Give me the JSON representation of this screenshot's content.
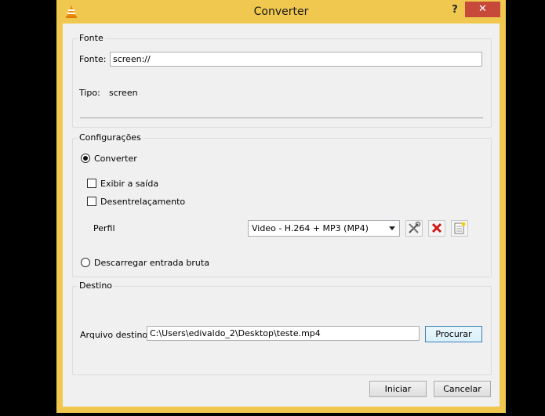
{
  "window": {
    "title": "Converter",
    "help": "?",
    "close": "✕"
  },
  "fonte": {
    "group_title": "Fonte",
    "source_label": "Fonte:",
    "source_value": "screen://",
    "type_label": "Tipo:",
    "type_value": "screen"
  },
  "configuracoes": {
    "group_title": "Configurações",
    "convert_label": "Converter",
    "convert_selected": true,
    "show_output_label": "Exibir a saída",
    "show_output_checked": false,
    "deinterlace_label": "Desentrelaçamento",
    "deinterlace_checked": false,
    "profile_label": "Perfil",
    "profile_value": "Video - H.264 + MP3 (MP4)",
    "raw_dump_label": "Descarregar entrada bruta",
    "raw_dump_selected": false,
    "icons": [
      "edit-profile-icon",
      "delete-profile-icon",
      "new-profile-icon"
    ]
  },
  "destino": {
    "group_title": "Destino",
    "file_label": "Arquivo destino:",
    "file_value": "C:\\Users\\edivaldo_2\\Desktop\\teste.mp4",
    "browse_label": "Procurar"
  },
  "buttons": {
    "start": "Iniciar",
    "cancel": "Cancelar"
  }
}
